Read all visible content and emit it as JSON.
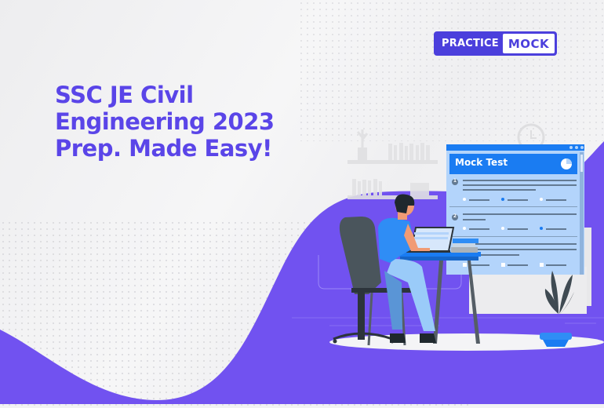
{
  "brand": {
    "practice": "PRACTICE",
    "mock": "MOCK"
  },
  "headline": {
    "line1": "SSC JE Civil",
    "line2": "Engineering 2023",
    "line3": "Prep. Made Easy!"
  },
  "mock_window": {
    "title": "Mock Test",
    "questions": [
      "1",
      "2"
    ]
  },
  "colors": {
    "brand": "#4b3fdc",
    "headline": "#5a45e8",
    "wave": "#7152f0",
    "window": "#b3d4fb",
    "window_header": "#1a7cf2"
  }
}
